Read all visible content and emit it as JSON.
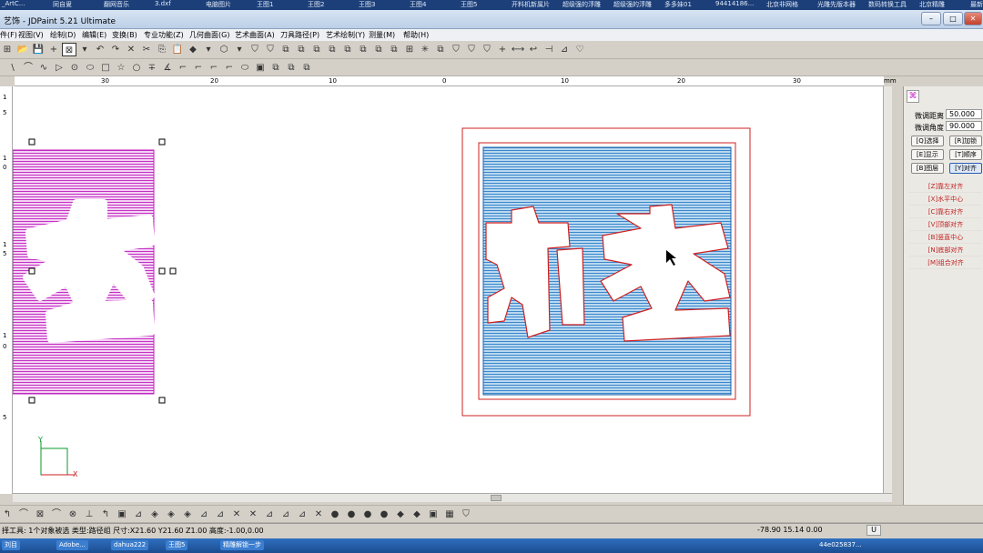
{
  "taskbar_top": {
    "items": [
      "_ArtC...",
      "同自叟",
      "翻网音乐",
      "3.dxf",
      "电脑图片",
      "王图1",
      "王图2",
      "王图3",
      "王图4",
      "王图5",
      "开料机新属片",
      "超级强的浮雕",
      "超级强的浮雕",
      "多多妹01",
      "94414186...",
      "北京非网格",
      "光雕先版本器",
      "数码转换工具",
      "北京精雕",
      "最新学习资料"
    ]
  },
  "window": {
    "title": "艺饰 - JDPaint 5.21 Ultimate",
    "min": "–",
    "max": "□",
    "close": "✕"
  },
  "menu": [
    "件(F)",
    "视图(V)",
    "绘制(D)",
    "编辑(E)",
    "变换(B)",
    "专业功能(Z)",
    "几何曲面(G)",
    "艺术曲面(A)",
    "刀具路径(P)",
    "艺术绘制(Y)",
    "测量(M)",
    "帮助(H)"
  ],
  "toolbar1": [
    "⊞",
    "📂",
    "💾",
    "+",
    "⊠",
    "▾",
    "↶",
    "↷",
    "✕",
    "✂",
    "⎘",
    "📋",
    "◆",
    "▾",
    "⬡",
    "▾",
    "⛉",
    "⛉",
    "⧉",
    "⧉",
    "⧉",
    "⧉",
    "⧉",
    "⧉",
    "⧉",
    "⧉",
    "⊞",
    "✳",
    "⧉",
    "⛉",
    "⛉",
    "⛉",
    "+",
    "⟷",
    "↩",
    "⊣",
    "⊿",
    "♡"
  ],
  "toolbar2": [
    "\\",
    "⌒",
    "∿",
    "▷",
    "⊙",
    "⬭",
    "□",
    "☆",
    "○",
    "∓",
    "∡",
    "⌐",
    "⌐",
    "⌐",
    "⌐",
    "⬭",
    "▣",
    "⧉",
    "⧉",
    "⧉"
  ],
  "ruler": {
    "unit": "mm",
    "h_ticks": [
      "30",
      "20",
      "10",
      "0",
      "10",
      "20",
      "30"
    ],
    "v_ticks": [
      "1",
      "5",
      "1",
      "0",
      "1",
      "5",
      "1",
      "0",
      "5"
    ]
  },
  "right_panel": {
    "fine_distance_label": "微调距离",
    "fine_distance_value": "50.000",
    "fine_angle_label": "微调角度",
    "fine_angle_value": "90.000",
    "buttons": [
      "[Q]选择",
      "[R]加锁",
      "[E]显示",
      "[T]顺序",
      "[B]图层",
      "[Y]对齐"
    ],
    "align_links": [
      "[Z]靠左对齐",
      "[X]水平中心",
      "[C]靠右对齐",
      "[V]顶部对齐",
      "[B]竖直中心",
      "[N]底部对齐",
      "[M]组合对齐"
    ]
  },
  "axis": {
    "x": "X",
    "y": "Y"
  },
  "bottom_toolbar": [
    "↰",
    "⌒",
    "⊠",
    "⌒",
    "⊗",
    "⊥",
    "↰",
    "▣",
    "⊿",
    "◈",
    "◈",
    "◈",
    "⊿",
    "⊿",
    "✕",
    "✕",
    "⊿",
    "⊿",
    "⊿",
    "✕",
    "●",
    "●",
    "●",
    "●",
    "◆",
    "◆",
    "▣",
    "▦",
    "⛉"
  ],
  "status": {
    "left": "择工具: 1个对象被选 类型:路径组 尺寸:X21.60 Y21.60 Z1.00 高度:-1.00,0.00",
    "coords": "-78.90 15.14 0.00",
    "mode": "U"
  },
  "taskbar_bottom": {
    "items": [
      "刘目",
      "Adobe...",
      "dahua222",
      "王图5",
      "精雕解锁一步"
    ],
    "clock": "44e025837..."
  },
  "colors": {
    "accent_magenta": "#c020c0",
    "accent_blue": "#2e7fc8",
    "outline_red": "#d02020"
  }
}
